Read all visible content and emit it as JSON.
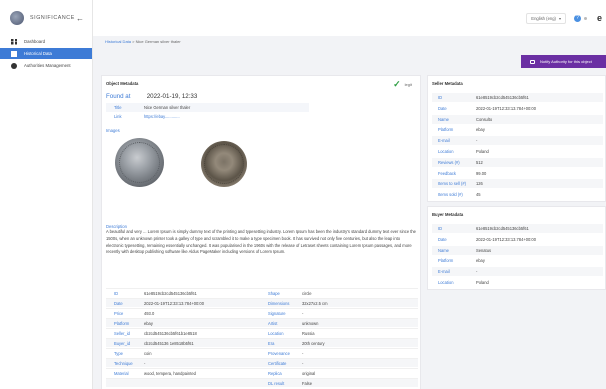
{
  "sidebar": {
    "logo_text": "SIGNIFICANCE",
    "items": [
      {
        "label": "Dashboard"
      },
      {
        "label": "Historical Data"
      },
      {
        "label": "Authorities Management"
      }
    ]
  },
  "topbar": {
    "language": "English (eng)",
    "avatar_letter": "e"
  },
  "breadcrumb": {
    "parent": "Historical Data",
    "separator": " > ",
    "current": "Nice German silver thaler"
  },
  "notify_button": {
    "label": "Notify Authority for this object"
  },
  "object_card": {
    "title": "Object Metadata",
    "legit_label": "legit",
    "found_label": "Found at",
    "found_value": "2022-01-19, 12:33",
    "title_label": "Title",
    "title_value": "Nice German silver thaler",
    "link_label": "Link",
    "link_value": "https://ebay.............",
    "images_label": "Images",
    "description_label": "Description",
    "description": "A beautiful and very ... Lorem Ipsum is simply dummy text of the printing and typesetting industry. Lorem Ipsum has been the industry's standard dummy text ever since the 1500s, when an unknown printer took a galley of type and scrambled it to make a type specimen book. It has survived not only five centuries, but also the leap into electronic typesetting, remaining essentially unchanged. It was popularised in the 1960s with the release of Letraset sheets containing Lorem Ipsum passages, and more recently with desktop publishing software like Aldus PageMaker including versions of Lorem Ipsum.",
    "details": [
      {
        "k1": "ID",
        "v1": "61e8519cb2cd545136cb5f61",
        "k2": "Shape",
        "v2": "circle"
      },
      {
        "k1": "Date",
        "v1": "2022-01-19T12:33:13.784+00:00",
        "k2": "Dimensions",
        "v2": "32x27x2.5 cm"
      },
      {
        "k1": "Price",
        "v1": "493.0",
        "k2": "Signature",
        "v2": "-"
      },
      {
        "k1": "Platform",
        "v1": "ebay",
        "k2": "Artist",
        "v2": "unknown"
      },
      {
        "k1": "Seller_id",
        "v1": "cb2cd545136cb5f61b1e8518",
        "k2": "Location",
        "v2": "Russia"
      },
      {
        "k1": "Buyer_id",
        "v1": "cb2cd545136 1e8518b5f61",
        "k2": "Era",
        "v2": "20th century"
      },
      {
        "k1": "Type",
        "v1": "coin",
        "k2": "Provenance",
        "v2": "-"
      },
      {
        "k1": "Technique",
        "v1": "-",
        "k2": "Certificate",
        "v2": "-"
      },
      {
        "k1": "Material",
        "v1": "wood, tempera, handpainted",
        "k2": "Replica",
        "v2": "original"
      },
      {
        "k1": "",
        "v1": "",
        "k2": "DL result",
        "v2": "False"
      }
    ]
  },
  "seller_card": {
    "title": "Seller Metadata",
    "rows": [
      {
        "k": "ID",
        "v": "61e8519cb2cd545136cb5f61"
      },
      {
        "k": "Date",
        "v": "2022-01-19T12:33:13.784+00:00"
      },
      {
        "k": "Name",
        "v": "Consulto"
      },
      {
        "k": "Platform",
        "v": "ebay"
      },
      {
        "k": "E-mail",
        "v": "-"
      },
      {
        "k": "Location",
        "v": "Poland"
      },
      {
        "k": "Reviews (#)",
        "v": "512"
      },
      {
        "k": "Feedback",
        "v": "99.00"
      },
      {
        "k": "Items to sell (#)",
        "v": "126"
      },
      {
        "k": "Items sold (#)",
        "v": "45"
      }
    ]
  },
  "buyer_card": {
    "title": "Buyer Metadata",
    "rows": [
      {
        "k": "ID",
        "v": "61e8519cb2cd545136cb5f61"
      },
      {
        "k": "Date",
        "v": "2022-01-19T12:33:13.784+00:00"
      },
      {
        "k": "Name",
        "v": "Senatus"
      },
      {
        "k": "Platform",
        "v": "ebay"
      },
      {
        "k": "E-mail",
        "v": "-"
      },
      {
        "k": "Location",
        "v": "Poland"
      }
    ]
  },
  "colors": {
    "accent": "#3d7bd6",
    "notify": "#6b2fa3",
    "legit": "#2e9e44"
  }
}
